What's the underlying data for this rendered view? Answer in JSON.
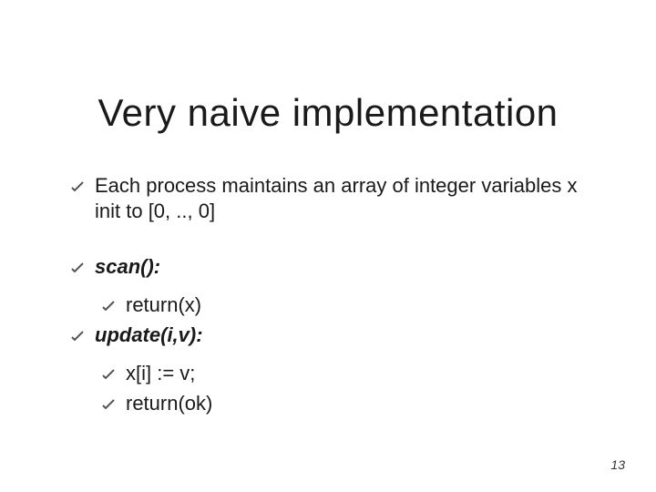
{
  "title": "Very naive implementation",
  "bullets": {
    "intro": "Each process maintains an array of integer variables x init to [0, .., 0]",
    "scan_label": "scan():",
    "scan_body": "return(x)",
    "update_label": "update(i,v):",
    "update_body1": "x[i] := v;",
    "update_body2": "return(ok)"
  },
  "page_number": "13"
}
